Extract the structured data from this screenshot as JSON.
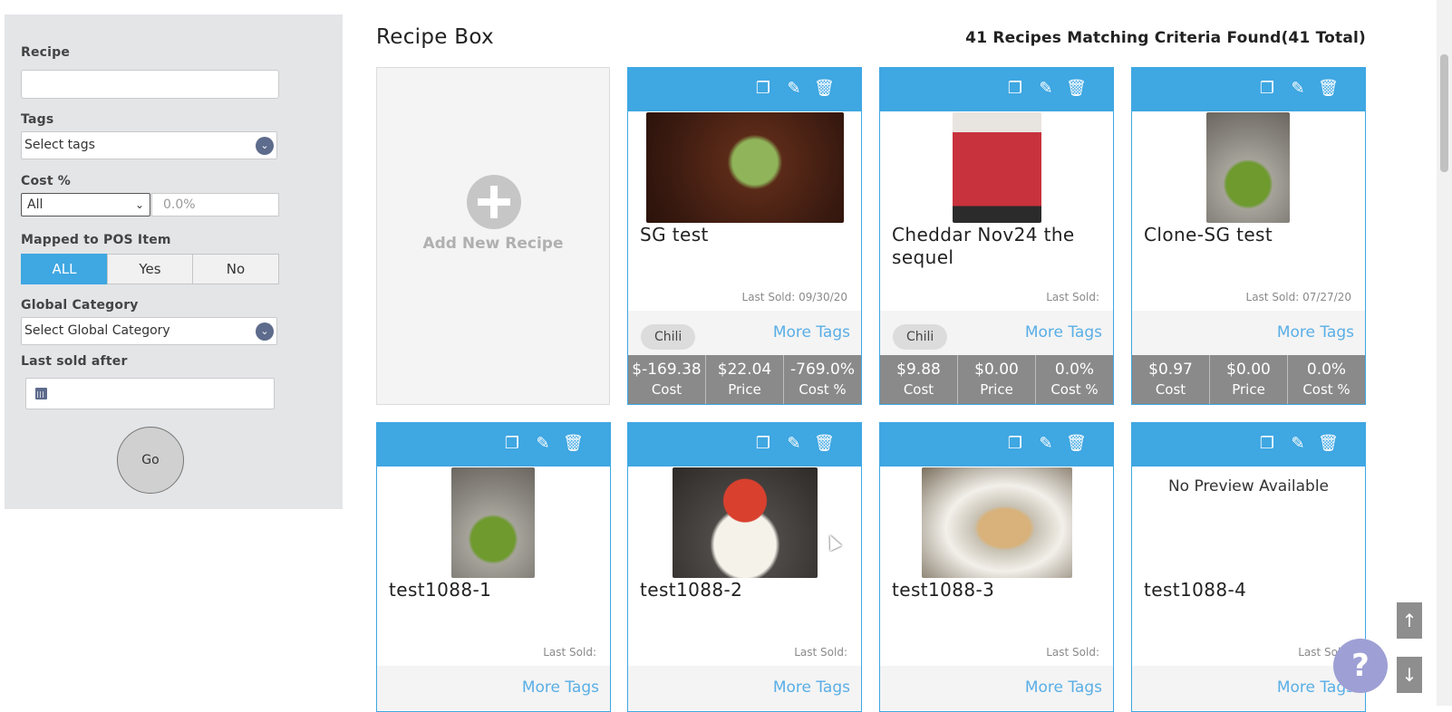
{
  "sidebar": {
    "recipe_label": "Recipe",
    "recipe_value": "",
    "tags_label": "Tags",
    "tags_placeholder": "Select tags",
    "cost_label": "Cost %",
    "cost_select": "All",
    "cost_placeholder": "0.0%",
    "pos_label": "Mapped to POS Item",
    "pos_options": [
      "ALL",
      "Yes",
      "No"
    ],
    "pos_selected": "ALL",
    "category_label": "Global Category",
    "category_placeholder": "Select Global Category",
    "last_sold_label": "Last sold after",
    "last_sold_value": "",
    "go_label": "Go"
  },
  "header": {
    "title": "Recipe Box",
    "summary": "41 Recipes Matching Criteria Found(41 Total)"
  },
  "add_card": {
    "label": "Add New Recipe"
  },
  "recipes": [
    {
      "name": "SG test",
      "last_sold": "Last Sold: 09/30/20",
      "tag": "Chili",
      "more_tags": "More Tags",
      "cost": "$-169.38",
      "price": "$22.04",
      "cost_pct": "-769.0%",
      "cost_lbl": "Cost",
      "price_lbl": "Price",
      "cost_pct_lbl": "Cost %"
    },
    {
      "name": "Cheddar Nov24 the sequel",
      "last_sold": "Last Sold:",
      "tag": "Chili",
      "more_tags": "More Tags",
      "cost": "$9.88",
      "price": "$0.00",
      "cost_pct": "0.0%",
      "cost_lbl": "Cost",
      "price_lbl": "Price",
      "cost_pct_lbl": "Cost %"
    },
    {
      "name": "Clone-SG test",
      "last_sold": "Last Sold: 07/27/20",
      "tag": "",
      "more_tags": "More Tags",
      "cost": "$0.97",
      "price": "$0.00",
      "cost_pct": "0.0%",
      "cost_lbl": "Cost",
      "price_lbl": "Price",
      "cost_pct_lbl": "Cost %"
    },
    {
      "name": "test1088-1",
      "last_sold": "Last Sold:",
      "more_tags": "More Tags"
    },
    {
      "name": "test1088-2",
      "last_sold": "Last Sold:",
      "more_tags": "More Tags"
    },
    {
      "name": "test1088-3",
      "last_sold": "Last Sold:",
      "more_tags": "More Tags"
    },
    {
      "name": "test1088-4",
      "last_sold": "Last Sold:",
      "more_tags": "More Tags",
      "no_preview": "No Preview Available"
    }
  ],
  "controls": {
    "scroll_up": "↑",
    "scroll_down": "↓",
    "help": "?"
  },
  "icons": {
    "copy": "copy-icon",
    "edit": "pencil-icon",
    "delete": "trash-icon"
  },
  "colors": {
    "accent": "#3fa7e2",
    "stats_bg": "#8a8a8a",
    "help": "#9e9fd4"
  }
}
